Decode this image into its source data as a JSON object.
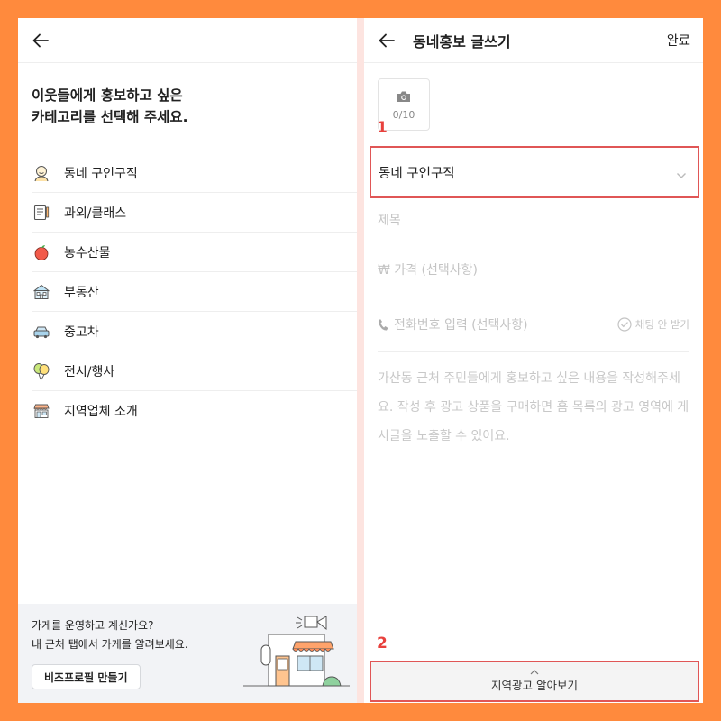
{
  "left": {
    "title": "이웃들에게 홍보하고 싶은\n카테고리를 선택해 주세요.",
    "categories": [
      {
        "label": "동네 구인구직",
        "icon": "person-icon"
      },
      {
        "label": "과외/클래스",
        "icon": "notebook-icon"
      },
      {
        "label": "농수산물",
        "icon": "apple-icon"
      },
      {
        "label": "부동산",
        "icon": "house-icon"
      },
      {
        "label": "중고차",
        "icon": "car-icon"
      },
      {
        "label": "전시/행사",
        "icon": "balloon-icon"
      },
      {
        "label": "지역업체 소개",
        "icon": "shop-icon"
      }
    ],
    "biz": {
      "line1": "가게를 운영하고 계신가요?",
      "line2": "내 근처 탭에서 가게를 알려보세요.",
      "button": "비즈프로필 만들기"
    }
  },
  "right": {
    "title": "동네홍보 글쓰기",
    "done": "완료",
    "photo_count": "0/10",
    "selected_category": "동네 구인구직",
    "title_placeholder": "제목",
    "price_placeholder": "₩ 가격 (선택사항)",
    "phone_placeholder": "전화번호 입력 (선택사항)",
    "chat_option": "채팅 안 받기",
    "body_placeholder": "가산동 근처 주민들에게 홍보하고 싶은 내용을 작성해주세요. 작성 후 광고 상품을 구매하면 홈 목록의 광고 영역에 게시글을 노출할 수 있어요.",
    "bottom_bar": "지역광고 알아보기"
  },
  "annotations": {
    "first": "1",
    "second": "2"
  },
  "colors": {
    "accent": "#ff8a3d",
    "highlight": "#e05656"
  }
}
